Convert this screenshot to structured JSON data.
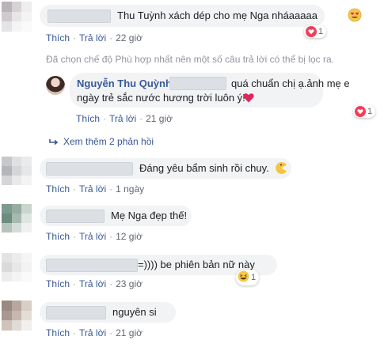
{
  "comments": [
    {
      "text": "Thu Tuỳnh xách dép cho mẹ Nga nháaaaaa",
      "like": "Thích",
      "reply": "Trả lời",
      "time": "22 giờ",
      "reaction_count": "1"
    },
    {
      "text": "Đáng yêu bẩm sinh rồi chuy.",
      "like": "Thích",
      "reply": "Trả lời",
      "time": "1 ngày"
    },
    {
      "text": "Mẹ Nga đẹp thế!",
      "like": "Thích",
      "reply": "Trả lời",
      "time": "12 giờ"
    },
    {
      "text": "=)))) be phiên bản nữ này",
      "like": "Thích",
      "reply": "Trả lời",
      "time": "23 giờ",
      "reaction_count": "1"
    },
    {
      "text": "nguyên si",
      "like": "Thích",
      "reply": "Trả lời",
      "time": "21 giờ"
    }
  ],
  "filter_notice": "Đã chọn chế độ Phù hợp nhất nên một số câu trả lời có thể bị lọc ra.",
  "reply": {
    "author": "Nguyễn Thu Quỳnh",
    "text_line1": "quá chuẩn chị ạ.ảnh mẹ e",
    "text_line2": "ngày trẻ sắc nước hương trời luôn ý!",
    "like": "Thích",
    "reply": "Trả lời",
    "time": "21 giờ",
    "reaction_count": "1"
  },
  "more_replies": "Xem thêm 2 phản hồi",
  "icons": {
    "heart": "heart-icon",
    "heart_eyes": "heart-eyes-emoji",
    "haha": "laughing-emoji",
    "pacman": "pacman-emoji",
    "reply_arrow": "reply-arrow-icon"
  },
  "colors": {
    "link": "#385898",
    "meta": "#606770",
    "bubble": "#f2f3f5",
    "heart": "#f33e58"
  }
}
